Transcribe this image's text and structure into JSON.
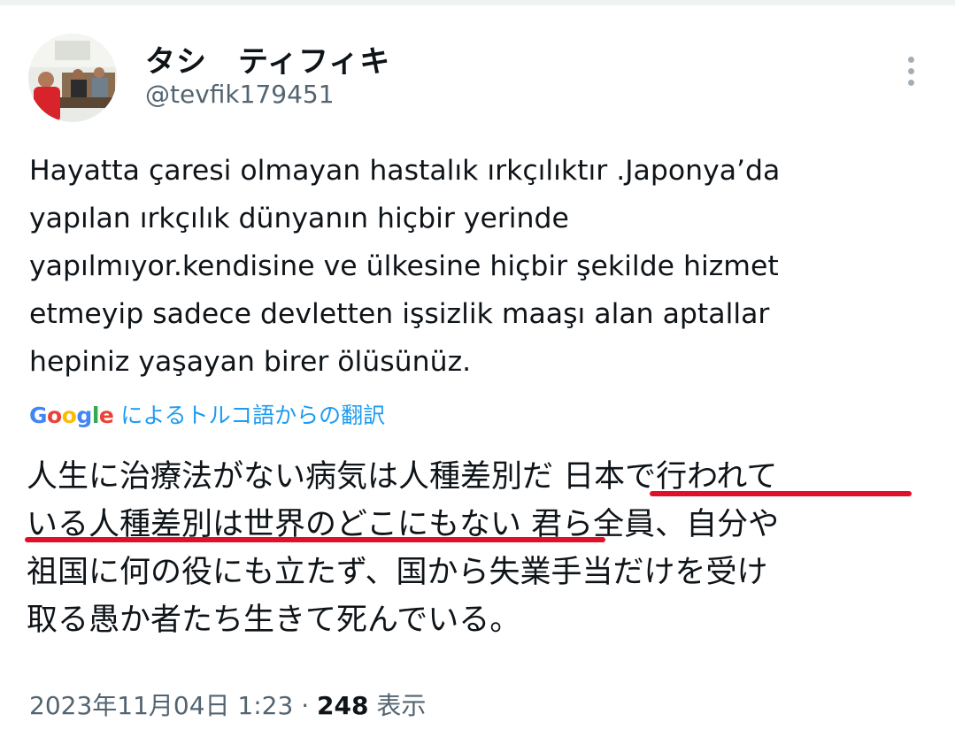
{
  "author": {
    "display_name": "タシ　ティフィキ",
    "handle": "@tevfik179451"
  },
  "tweet": {
    "text_lines": [
      "Hayatta çaresi olmayan hastalık ırkçılıktır .Japonya’da",
      "yapılan ırkçılık dünyanın hiçbir yerinde",
      "yapılmıyor.kendisine ve ülkesine hiçbir şekilde hizmet",
      "etmeyip sadece devletten işsizlik maaşı alan aptallar",
      "hepiniz yaşayan birer ölüsünüz."
    ]
  },
  "translation": {
    "provider_letters": [
      "G",
      "o",
      "o",
      "g",
      "l",
      "e"
    ],
    "label": "によるトルコ語からの翻訳",
    "lines": [
      "人生に治療法がない病気は人種差別だ 日本で行われて",
      "いる人種差別は世界のどこにもない 君ら全員、自分や",
      "祖国に何の役にも立たず、国から失業手当だけを受け",
      "取る愚か者たち生きて死んでいる。"
    ],
    "highlight_color": "#e0102a"
  },
  "meta": {
    "timestamp": "2023年11月04日 1:23",
    "separator": " · ",
    "views_count": "248",
    "views_label": " 表示"
  },
  "colors": {
    "text": "#0f1419",
    "secondary": "#536471",
    "link": "#1d9bf0"
  },
  "icons": {
    "more": "more-vertical-icon"
  }
}
